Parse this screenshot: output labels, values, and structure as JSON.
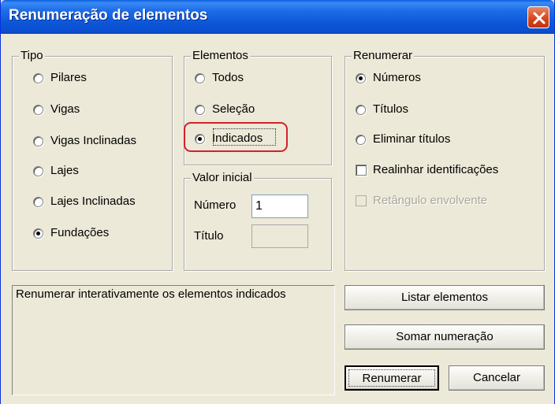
{
  "window": {
    "title": "Renumeração de elementos"
  },
  "tipo": {
    "legend": "Tipo",
    "options": [
      {
        "label": "Pilares",
        "checked": false
      },
      {
        "label": "Vigas",
        "checked": false
      },
      {
        "label": "Vigas Inclinadas",
        "checked": false
      },
      {
        "label": "Lajes",
        "checked": false
      },
      {
        "label": "Lajes Inclinadas",
        "checked": false
      },
      {
        "label": "Fundações",
        "checked": true
      }
    ]
  },
  "elementos": {
    "legend": "Elementos",
    "options": [
      {
        "label": "Todos",
        "checked": false
      },
      {
        "label": "Seleção",
        "checked": false
      },
      {
        "label": "Indicados",
        "checked": true
      }
    ]
  },
  "valor_inicial": {
    "legend": "Valor inicial",
    "numero_label": "Número",
    "numero_value": "1",
    "titulo_label": "Título",
    "titulo_value": ""
  },
  "renumerar": {
    "legend": "Renumerar",
    "options": [
      {
        "label": "Números",
        "checked": true
      },
      {
        "label": "Títulos",
        "checked": false
      },
      {
        "label": "Eliminar títulos",
        "checked": false
      }
    ],
    "checkboxes": [
      {
        "label": "Realinhar identificações",
        "checked": false,
        "enabled": true
      },
      {
        "label": "Retângulo envolvente",
        "checked": false,
        "enabled": false
      }
    ]
  },
  "status_text": "Renumerar interativamente os elementos indicados",
  "buttons": {
    "listar": "Listar elementos",
    "somar": "Somar numeração",
    "renumerar": "Renumerar",
    "cancelar": "Cancelar"
  },
  "colors": {
    "titlebar": "#0a5ee0",
    "dialog_bg": "#ece9d8",
    "highlight": "#d6202a",
    "close": "#d4431c"
  }
}
